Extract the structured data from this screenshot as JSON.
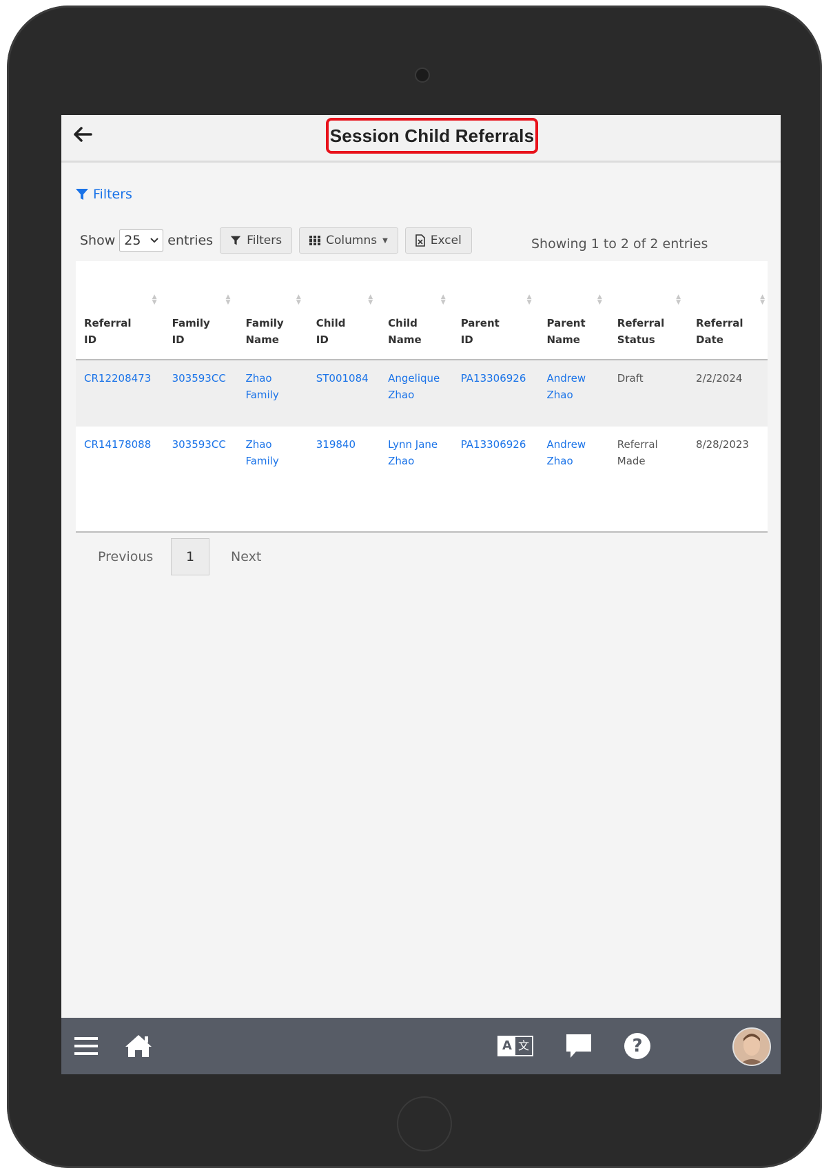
{
  "header": {
    "title": "Session Child Referrals"
  },
  "filters_link": {
    "label": "Filters"
  },
  "controls": {
    "show_label": "Show",
    "page_size": "25",
    "entries_label": "entries",
    "filters_button": "Filters",
    "columns_button": "Columns",
    "excel_button": "Excel"
  },
  "summary": "Showing 1 to 2 of 2 entries",
  "table": {
    "headers": [
      [
        "Referral",
        "ID"
      ],
      [
        "Family",
        "ID"
      ],
      [
        "Family",
        "Name"
      ],
      [
        "Child",
        "ID"
      ],
      [
        "Child",
        "Name"
      ],
      [
        "Parent",
        "ID"
      ],
      [
        "Parent",
        "Name"
      ],
      [
        "Referral",
        "Status"
      ],
      [
        "Referral",
        "Date"
      ]
    ],
    "rows": [
      {
        "referral_id": "CR12208473",
        "family_id": "303593CC",
        "family_name": [
          "Zhao",
          "Family"
        ],
        "child_id": "ST001084",
        "child_name": [
          "Angelique",
          "Zhao"
        ],
        "parent_id": "PA13306926",
        "parent_name": [
          "Andrew",
          "Zhao"
        ],
        "status": [
          "Draft",
          ""
        ],
        "date": "2/2/2024"
      },
      {
        "referral_id": "CR14178088",
        "family_id": "303593CC",
        "family_name": [
          "Zhao",
          "Family"
        ],
        "child_id": "319840",
        "child_name": [
          "Lynn Jane",
          "Zhao"
        ],
        "parent_id": "PA13306926",
        "parent_name": [
          "Andrew",
          "Zhao"
        ],
        "status": [
          "Referral",
          "Made"
        ],
        "date": "8/28/2023"
      }
    ]
  },
  "pagination": {
    "previous": "Previous",
    "current": "1",
    "next": "Next"
  },
  "bottom_bar": {
    "icons": [
      "menu-icon",
      "home-icon",
      "translate-icon",
      "chat-icon",
      "help-icon",
      "avatar"
    ],
    "translate_glyph_a": "A",
    "translate_glyph_b": "文",
    "help_glyph": "?"
  },
  "colors": {
    "link": "#1a73e8",
    "highlight": "#e8121b",
    "bottom_bar": "#575c66"
  }
}
